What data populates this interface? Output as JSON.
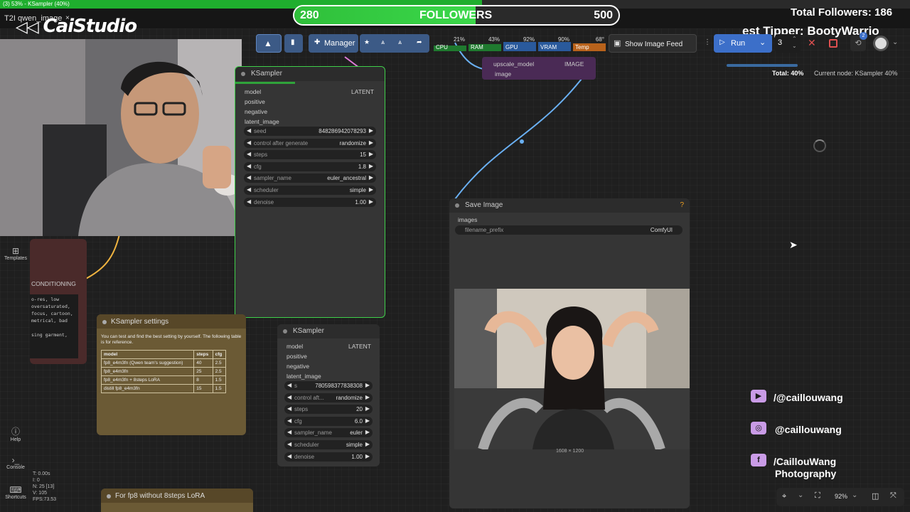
{
  "window": {
    "title": "(3) 53% - KSampler (40%)",
    "tab_label": "T2I qwen_image",
    "tab_close": "×"
  },
  "stream": {
    "logo": "CaiStudio",
    "followers": {
      "label": "FOLLOWERS",
      "current": "280",
      "goal": "500",
      "progress": 0.56
    },
    "total_followers": "Total Followers: 186",
    "tipper": "est Tipper: BootyWarrio",
    "socials": [
      {
        "icon": "youtube-icon",
        "text": "/@caillouwang"
      },
      {
        "icon": "instagram-icon",
        "text": "@caillouwang"
      },
      {
        "icon": "facebook-icon",
        "text": "/CaillouWang",
        "sub": "Photography"
      }
    ],
    "accent": "#c99be6"
  },
  "toolbar": {
    "manager_label": "Manager",
    "meters": [
      {
        "name": "CPU",
        "value": "21%"
      },
      {
        "name": "RAM",
        "value": "43%"
      },
      {
        "name": "GPU",
        "value": "92%"
      },
      {
        "name": "VRAM",
        "value": "90%"
      },
      {
        "name": "Temp",
        "value": "68°"
      }
    ],
    "show_image_feed": "Show Image Feed",
    "run_label": "Run",
    "batch_count": "3",
    "queue_badge": "2",
    "progress_total": "Total: 40%",
    "current_node": "Current node: KSampler 40%",
    "zoom": "92%"
  },
  "sidebar": {
    "templates": "Templates",
    "help": "Help",
    "console": "Console",
    "shortcuts": "Shortcuts"
  },
  "stats": {
    "t": "T: 0.00s",
    "i": "I: 0",
    "n": "N: 25 [13]",
    "v": "V: 105",
    "fps": "FPS:73.53"
  },
  "nodes": {
    "ksampler1": {
      "title": "KSampler",
      "inputs": [
        "model",
        "positive",
        "negative",
        "latent_image"
      ],
      "output": "LATENT",
      "widgets": [
        {
          "label": "seed",
          "value": "848286942078293"
        },
        {
          "label": "control after generate",
          "value": "randomize"
        },
        {
          "label": "steps",
          "value": "15"
        },
        {
          "label": "cfg",
          "value": "1.8"
        },
        {
          "label": "sampler_name",
          "value": "euler_ancestral"
        },
        {
          "label": "scheduler",
          "value": "simple"
        },
        {
          "label": "denoise",
          "value": "1.00"
        }
      ]
    },
    "ksampler2": {
      "title": "KSampler",
      "inputs": [
        "model",
        "positive",
        "negative",
        "latent_image"
      ],
      "output": "LATENT",
      "widgets": [
        {
          "label": "s",
          "value": "780598377838308"
        },
        {
          "label": "control aft...",
          "value": "randomize"
        },
        {
          "label": "steps",
          "value": "20"
        },
        {
          "label": "cfg",
          "value": "6.0"
        },
        {
          "label": "sampler_name",
          "value": "euler"
        },
        {
          "label": "scheduler",
          "value": "simple"
        },
        {
          "label": "denoise",
          "value": "1.00"
        }
      ]
    },
    "upscale": {
      "input1": "upscale_model",
      "input2": "image",
      "output": "IMAGE"
    },
    "save_image": {
      "title": "Save Image",
      "help": "?",
      "input": "images",
      "filename_label": "filename_prefix",
      "filename_value": "ComfyUI",
      "dimensions": "1608 × 1200"
    },
    "conditioning": {
      "label": "CONDITIONING",
      "text": [
        "o-res, low",
        "oversaturated,",
        "focus, cartoon,",
        "metrical, bad",
        "",
        "sing garment,"
      ]
    },
    "settings_note": {
      "title": "KSampler settings",
      "intro": "You can test and find the best setting by yourself. The following table is for reference.",
      "columns": [
        "model",
        "steps",
        "cfg"
      ],
      "rows": [
        [
          "fp8_e4m3fn  (Qwen team's suggestion)",
          "40",
          "2.5"
        ],
        [
          "fp8_e4m3fn",
          "25",
          "2.5"
        ],
        [
          "fp8_e4m3fn + 8steps LoRA",
          "8",
          "1.5"
        ],
        [
          "distill fp8_e4m3fn",
          "15",
          "1.5"
        ]
      ]
    },
    "lora_note": {
      "title": "For fp8 without 8steps LoRA"
    }
  }
}
